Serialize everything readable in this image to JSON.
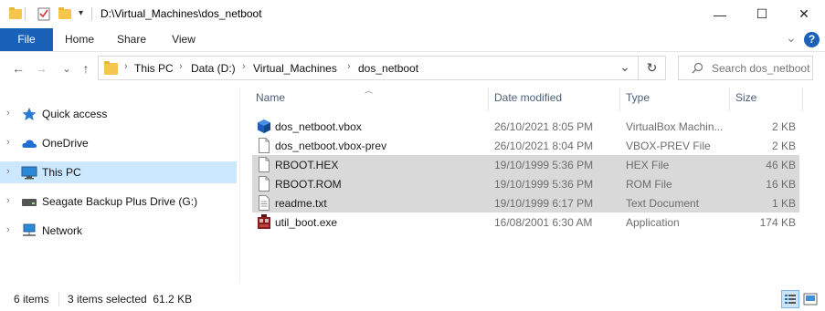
{
  "window": {
    "title": "D:\\Virtual_Machines\\dos_netboot",
    "minimize_glyph": "—",
    "maximize_glyph": "☐",
    "close_glyph": "✕"
  },
  "ribbon": {
    "tabs": [
      "File",
      "Home",
      "Share",
      "View"
    ],
    "expand_glyph": "⌄",
    "help_glyph": "?"
  },
  "address": {
    "crumbs": [
      "This PC",
      "Data (D:)",
      "Virtual_Machines",
      "dos_netboot"
    ],
    "separator": "›",
    "dropdown_glyph": "⌄",
    "refresh_glyph": "↻"
  },
  "search": {
    "placeholder": "Search dos_netboot"
  },
  "nav_buttons": {
    "back": "←",
    "forward": "→",
    "recent": "⌄",
    "up": "↑"
  },
  "sidebar": {
    "items": [
      {
        "label": "Quick access",
        "icon": "star-icon"
      },
      {
        "label": "OneDrive",
        "icon": "cloud-icon"
      },
      {
        "label": "This PC",
        "icon": "computer-icon",
        "selected": true
      },
      {
        "label": "Seagate Backup Plus Drive (G:)",
        "icon": "drive-icon"
      },
      {
        "label": "Network",
        "icon": "network-icon"
      }
    ]
  },
  "columns": {
    "name": "Name",
    "date": "Date modified",
    "type": "Type",
    "size": "Size"
  },
  "files": [
    {
      "name": "dos_netboot.vbox",
      "date": "26/10/2021 8:05 PM",
      "type": "VirtualBox Machin...",
      "size": "2 KB",
      "icon": "virtualbox-icon",
      "selected": false
    },
    {
      "name": "dos_netboot.vbox-prev",
      "date": "26/10/2021 8:04 PM",
      "type": "VBOX-PREV File",
      "size": "2 KB",
      "icon": "file-icon",
      "selected": false
    },
    {
      "name": "RBOOT.HEX",
      "date": "19/10/1999 5:36 PM",
      "type": "HEX File",
      "size": "46 KB",
      "icon": "file-icon",
      "selected": true
    },
    {
      "name": "RBOOT.ROM",
      "date": "19/10/1999 5:36 PM",
      "type": "ROM File",
      "size": "16 KB",
      "icon": "file-icon",
      "selected": true
    },
    {
      "name": "readme.txt",
      "date": "19/10/1999 6:17 PM",
      "type": "Text Document",
      "size": "1 KB",
      "icon": "text-file-icon",
      "selected": true
    },
    {
      "name": "util_boot.exe",
      "date": "16/08/2001 6:30 AM",
      "type": "Application",
      "size": "174 KB",
      "icon": "application-icon",
      "selected": false
    }
  ],
  "status": {
    "items": "6 items",
    "selection": "3 items selected  61.2 KB"
  },
  "colors": {
    "accent": "#1a62b8",
    "selected_nav": "#cce8ff",
    "selected_row": "#d9d9d9"
  }
}
